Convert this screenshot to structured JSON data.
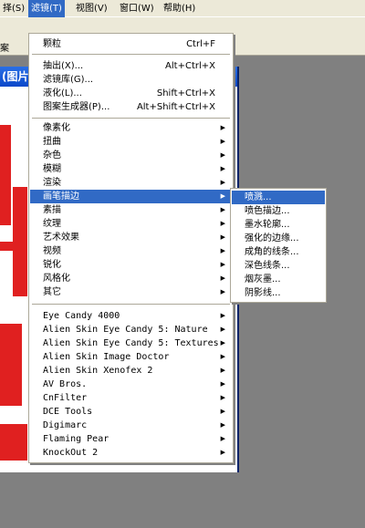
{
  "menubar": {
    "items": [
      {
        "label": "择(S)"
      },
      {
        "label": "滤镜(T)"
      },
      {
        "label": "视图(V)"
      },
      {
        "label": "窗口(W)"
      },
      {
        "label": "帮助(H)"
      }
    ]
  },
  "toolbar": {
    "text": "案"
  },
  "document": {
    "title": "(图片"
  },
  "filter_menu": {
    "top": [
      {
        "label": "颗粒",
        "shortcut": "Ctrl+F"
      }
    ],
    "group2": [
      {
        "label": "抽出(X)...",
        "shortcut": "Alt+Ctrl+X"
      },
      {
        "label": "滤镜库(G)...",
        "shortcut": ""
      },
      {
        "label": "液化(L)...",
        "shortcut": "Shift+Ctrl+X"
      },
      {
        "label": "图案生成器(P)...",
        "shortcut": "Alt+Shift+Ctrl+X"
      }
    ],
    "group3": [
      {
        "label": "像素化"
      },
      {
        "label": "扭曲"
      },
      {
        "label": "杂色"
      },
      {
        "label": "模糊"
      },
      {
        "label": "渲染"
      },
      {
        "label": "画笔描边",
        "highlighted": true
      },
      {
        "label": "素描"
      },
      {
        "label": "纹理"
      },
      {
        "label": "艺术效果"
      },
      {
        "label": "视频"
      },
      {
        "label": "锐化"
      },
      {
        "label": "风格化"
      },
      {
        "label": "其它"
      }
    ],
    "plugins": [
      {
        "label": "Eye Candy 4000"
      },
      {
        "label": "Alien Skin Eye Candy 5: Nature"
      },
      {
        "label": "Alien Skin Eye Candy 5: Textures"
      },
      {
        "label": "Alien Skin Image Doctor"
      },
      {
        "label": "Alien Skin Xenofex 2"
      },
      {
        "label": "AV Bros."
      },
      {
        "label": "CnFilter"
      },
      {
        "label": "DCE Tools"
      },
      {
        "label": "Digimarc"
      },
      {
        "label": "Flaming Pear"
      },
      {
        "label": "KnockOut 2"
      }
    ]
  },
  "brush_submenu": {
    "items": [
      {
        "label": "喷溅...",
        "highlighted": true
      },
      {
        "label": "喷色描边..."
      },
      {
        "label": "墨水轮廓..."
      },
      {
        "label": "强化的边缘..."
      },
      {
        "label": "成角的线条..."
      },
      {
        "label": "深色线条..."
      },
      {
        "label": "烟灰墨..."
      },
      {
        "label": "阴影线..."
      }
    ]
  },
  "colors": {
    "highlight": "#316AC5",
    "menu_bg": "#FFFFFF",
    "bar_bg": "#ECE9D8",
    "stamp": "#E02020"
  }
}
